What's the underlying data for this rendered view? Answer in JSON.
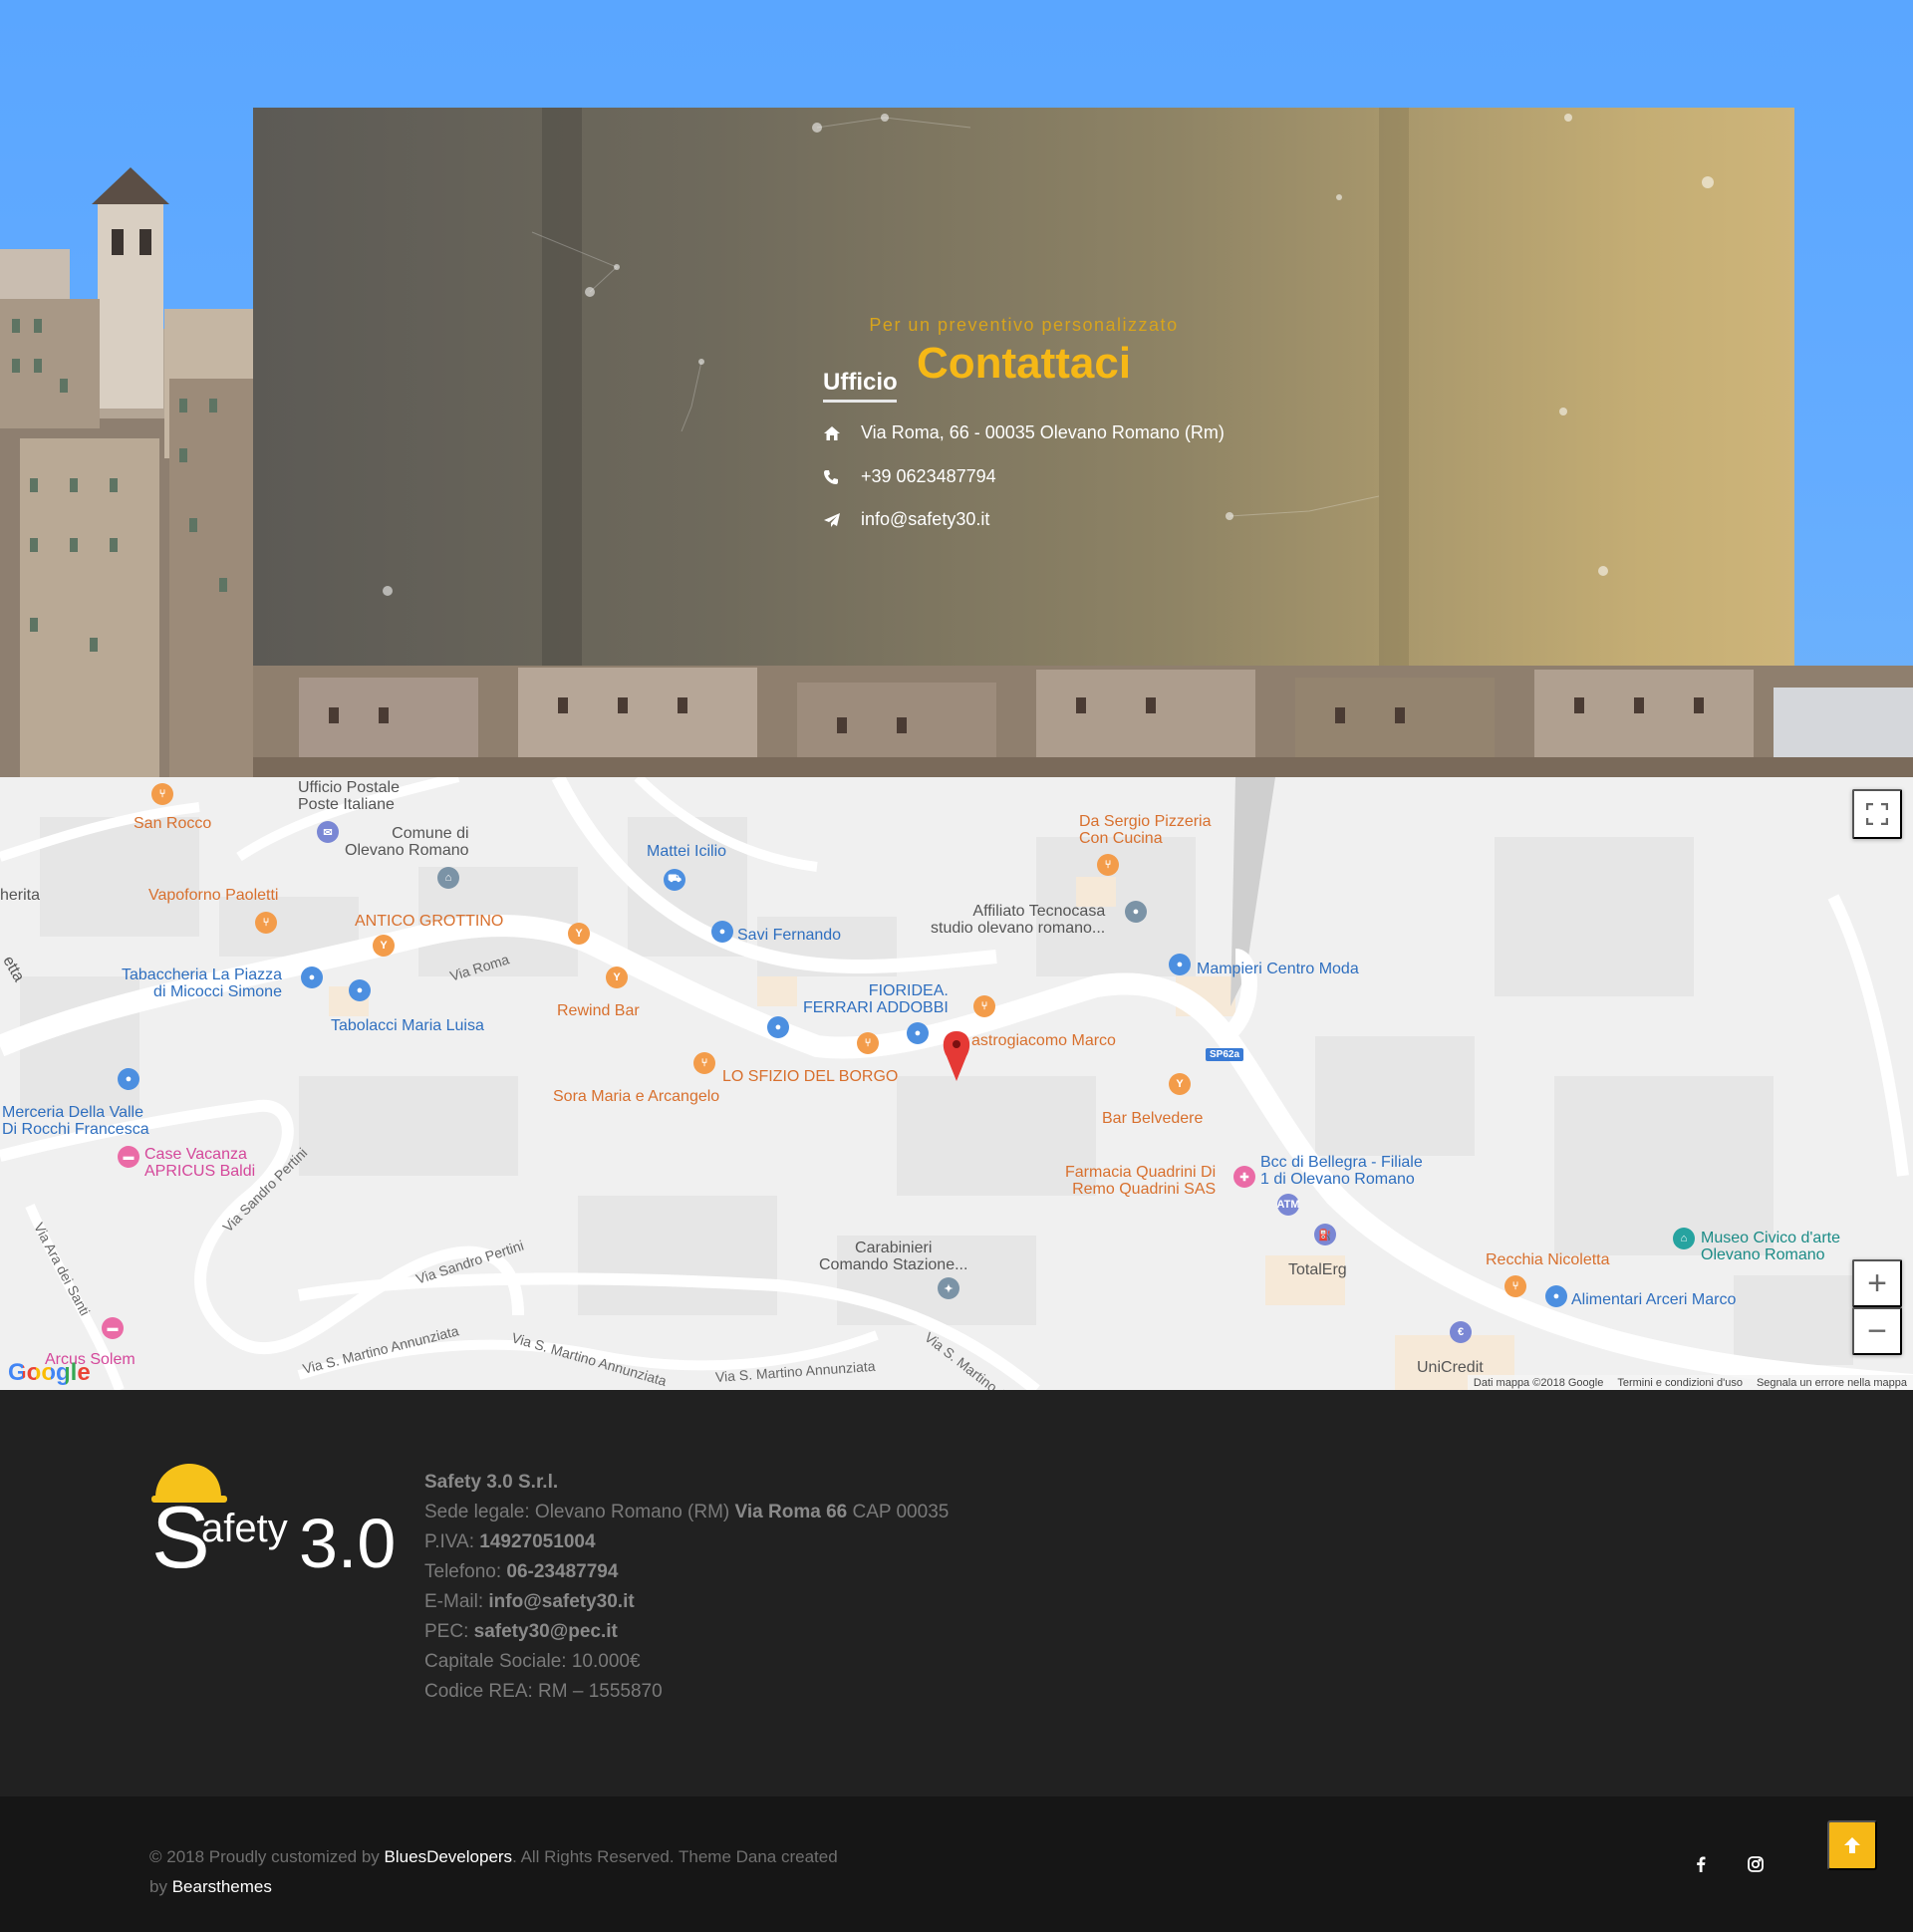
{
  "contact": {
    "subtitle": "Per un preventivo personalizzato",
    "title": "Contattaci",
    "office": {
      "title": "Ufficio",
      "address": "Via Roma, 66 - 00035 Olevano Romano (Rm)",
      "phone": "+39 0623487794",
      "email": "info@safety30.it"
    }
  },
  "map": {
    "labels": {
      "ufficio_postale": "Ufficio Postale\nPoste Italiane",
      "san_rocco": "San Rocco",
      "comune": "Comune di\nOlevano Romano",
      "mattei": "Mattei Icilio",
      "da_sergio": "Da Sergio Pizzeria\nCon Cucina",
      "merita": "herita",
      "vapoforno": "Vapoforno Paoletti",
      "antico": "ANTICO GROTTINO",
      "affiliato": "Affiliato Tecnocasa\nstudio olevano romano...",
      "savi": "Savi Fernando",
      "mampieri": "Mampieri Centro Moda",
      "tabaccheria": "Tabaccheria La Piazza\ndi Micocci Simone",
      "fioridea": "FIORIDEA.\nFERRARI ADDOBBI",
      "rewind": "Rewind Bar",
      "tabolacci": "Tabolacci Maria Luisa",
      "mastrogiacomo": "astrogiacomo Marco",
      "sfizio": "LO SFIZIO DEL BORGO",
      "sora": "Sora Maria e Arcangelo",
      "merceria": "Merceria Della Valle\nDi Rocchi Francesca",
      "bar_belvedere": "Bar Belvedere",
      "case_vacanza": "Case Vacanza\nAPRICUS Baldi",
      "farmacia": "Farmacia Quadrini Di\nRemo Quadrini SAS",
      "bcc": "Bcc di Bellegra - Filiale\n1 di Olevano Romano",
      "museo": "Museo Civico d'arte\nOlevano Romano",
      "carabinieri": "Carabinieri\nComando Stazione...",
      "totalerg": "TotalErg",
      "recchia": "Recchia Nicoletta",
      "alimentari": "Alimentari Arceri Marco",
      "arcus": "Arcus Solem",
      "unicredit": "UniCredit",
      "etta": "etta"
    },
    "streets": {
      "via_roma": "Via Roma",
      "via_sandro_pertini_1": "Via Sandro Pertini",
      "via_sandro_pertini_2": "Via Sandro Pertini",
      "via_ara": "Via Ara dei Santi",
      "via_martino_1": "Via S. Martino Annunziata",
      "via_martino_2": "Via S. Martino Annunziata",
      "via_martino_3": "Via S. Martino Annunziata",
      "via_martino_4": "Via S. Martino Annunzi"
    },
    "road_badge": "SP62a",
    "google": "Google",
    "attribution": {
      "data": "Dati mappa ©2018 Google",
      "terms": "Termini e condizioni d'uso",
      "report": "Segnala un errore nella mappa"
    },
    "zoom_in": "+",
    "zoom_out": "−",
    "atm": "ATM"
  },
  "footer": {
    "logo_text": "Safety3.0",
    "company_name": "Safety 3.0 S.r.l.",
    "seat_label": "Sede legale: Olevano Romano (RM)",
    "seat_street": "Via Roma 66",
    "seat_cap": "CAP 00035",
    "piva_label": "P.IVA:",
    "piva": "14927051004",
    "tel_label": "Telefono:",
    "tel": "06-23487794",
    "email_label": "E-Mail:",
    "email": "info@safety30.it",
    "pec_label": "PEC:",
    "pec": "safety30@pec.it",
    "capital": "Capitale Sociale: 10.000€",
    "rea": "Codice REA: RM – 1555870"
  },
  "bottom": {
    "copy_1": "© 2018 Proudly customized by",
    "author": "BluesDevelopers",
    "copy_2": ". All Rights Reserved. Theme Dana created",
    "copy_3": "by",
    "theme_author": "Bearsthemes"
  },
  "colors": {
    "accent": "#f6b816",
    "footer_bg": "#212121",
    "bottom_bg": "#161616"
  }
}
